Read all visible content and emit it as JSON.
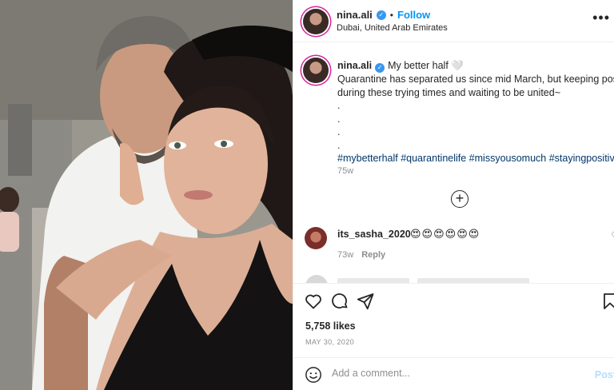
{
  "post": {
    "username": "nina.ali",
    "verified_mark": "✓",
    "separator": "•",
    "follow_label": "Follow",
    "location": "Dubai, United Arab Emirates",
    "more_icon": "more-horizontal-icon",
    "more_label": "•••"
  },
  "caption": {
    "username": "nina.ali",
    "lines": [
      "My better half 🤍",
      "Quarantine has separated us since mid March, but keeping positive",
      "during these trying times and waiting to be united~",
      ".",
      ".",
      ".",
      "."
    ],
    "hashtags": "#mybetterhalf #quarantinelife #missyousomuch #stayingpositive",
    "time": "75w"
  },
  "load_more": "+",
  "comments": [
    {
      "username": "its_sasha_2020",
      "text": "😍😍😍😍😍😍",
      "time": "73w",
      "reply_label": "Reply",
      "heart_icon": "heart-outline-icon",
      "heart_label": "♡"
    }
  ],
  "actions": {
    "icons": [
      "heart-outline-icon",
      "comment-icon",
      "share-icon",
      "bookmark-icon"
    ]
  },
  "likes": "5,758 likes",
  "date": "MAY 30, 2020",
  "add_comment": {
    "placeholder": "Add a comment...",
    "post_label": "Post",
    "emoji_icon": "smiley-icon"
  },
  "colors": {
    "link_blue": "#0095f6",
    "hashtag": "#00376b",
    "muted": "#8e8e8e",
    "post_disabled": "#b2dffc"
  }
}
